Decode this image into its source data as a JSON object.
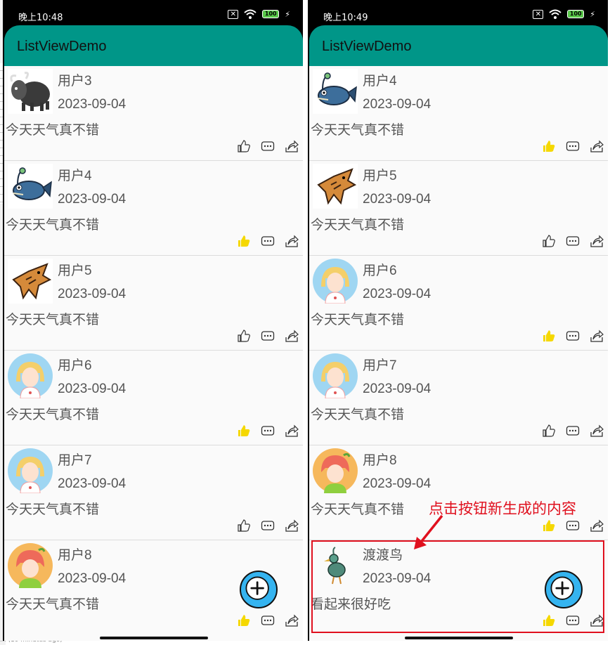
{
  "left": {
    "status_time": "晚上10:48",
    "battery": "100",
    "app_title": "ListViewDemo",
    "items": [
      {
        "user": "用户3",
        "date": "2023-09-04",
        "content": "今天天气真不错",
        "avatar": "yak-avatar",
        "liked": false
      },
      {
        "user": "用户4",
        "date": "2023-09-04",
        "content": "今天天气真不错",
        "avatar": "fish-avatar",
        "liked": true
      },
      {
        "user": "用户5",
        "date": "2023-09-04",
        "content": "今天天气真不错",
        "avatar": "beast-avatar",
        "liked": false
      },
      {
        "user": "用户6",
        "date": "2023-09-04",
        "content": "今天天气真不错",
        "avatar": "blonde-girl-avatar",
        "liked": true
      },
      {
        "user": "用户7",
        "date": "2023-09-04",
        "content": "今天天气真不错",
        "avatar": "blonde-girl-avatar",
        "liked": false
      },
      {
        "user": "用户8",
        "date": "2023-09-04",
        "content": "今天天气真不错",
        "avatar": "redhead-girl-avatar",
        "liked": true
      }
    ]
  },
  "right": {
    "status_time": "晚上10:49",
    "battery": "100",
    "app_title": "ListViewDemo",
    "items": [
      {
        "user": "用户4",
        "date": "2023-09-04",
        "content": "今天天气真不错",
        "avatar": "fish-avatar",
        "liked": true
      },
      {
        "user": "用户5",
        "date": "2023-09-04",
        "content": "今天天气真不错",
        "avatar": "beast-avatar",
        "liked": false
      },
      {
        "user": "用户6",
        "date": "2023-09-04",
        "content": "今天天气真不错",
        "avatar": "blonde-girl-avatar",
        "liked": true
      },
      {
        "user": "用户7",
        "date": "2023-09-04",
        "content": "今天天气真不错",
        "avatar": "blonde-girl-avatar",
        "liked": false
      },
      {
        "user": "用户8",
        "date": "2023-09-04",
        "content": "今天天气真不错",
        "avatar": "redhead-girl-avatar",
        "liked": true
      },
      {
        "user": "渡渡鸟",
        "date": "2023-09-04",
        "content": "看起来很好吃",
        "avatar": "dodo-bird-avatar",
        "liked": true
      }
    ]
  },
  "annotation": "点击按钮新生成的内容",
  "background_text": "... (10 minutes ago)",
  "colors": {
    "appbar": "#009688",
    "fab": "#35b4f0",
    "like_active": "#f5d800",
    "annotation": "#e0101e"
  }
}
